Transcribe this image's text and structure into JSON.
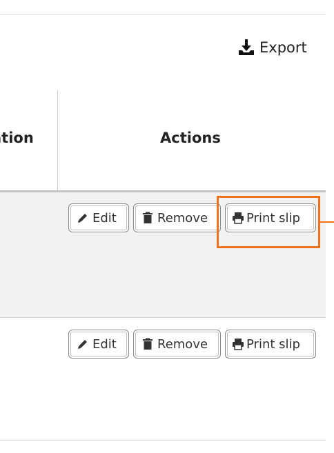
{
  "toolbar": {
    "export_label": "Export",
    "export_icon": "download-icon"
  },
  "table": {
    "columns": [
      {
        "label": "ation",
        "note_truncated": true
      },
      {
        "label": "Actions"
      }
    ],
    "rows": [
      {
        "actions": [
          {
            "label": "Edit",
            "icon": "pencil-icon"
          },
          {
            "label": "Remove",
            "icon": "trash-icon"
          },
          {
            "label": "Print slip",
            "icon": "printer-icon"
          }
        ]
      },
      {
        "actions": [
          {
            "label": "Edit",
            "icon": "pencil-icon"
          },
          {
            "label": "Remove",
            "icon": "trash-icon"
          },
          {
            "label": "Print slip",
            "icon": "printer-icon"
          }
        ]
      }
    ]
  },
  "highlight": {
    "color": "#f0731c",
    "target": "row-1 print slip button"
  },
  "colors": {
    "row_shade": "#f2f2f2",
    "highlight": "#f0731c"
  }
}
